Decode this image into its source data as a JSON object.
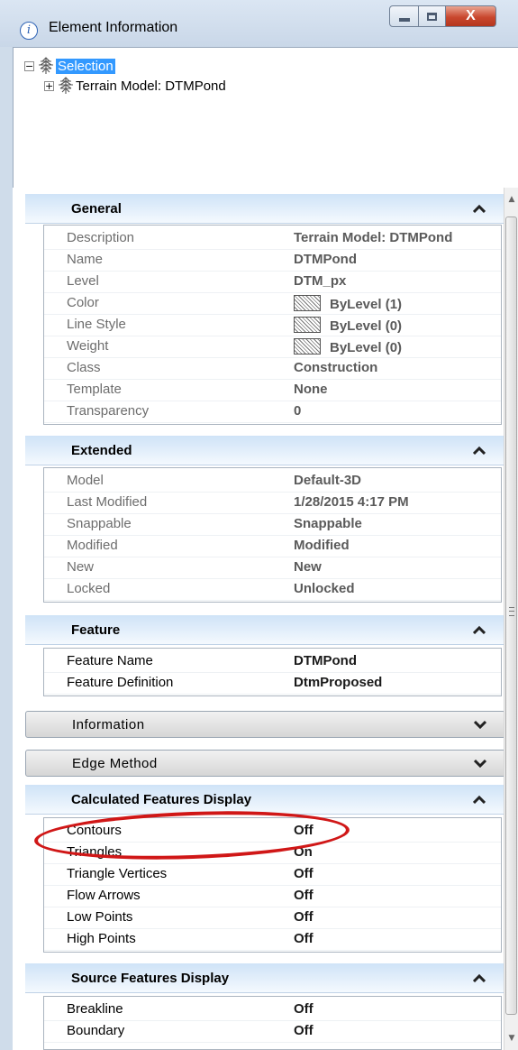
{
  "window": {
    "title": "Element Information",
    "close_glyph": "X"
  },
  "tree": {
    "root_label": "Selection",
    "root_expander": "−",
    "child_label": "Terrain Model: DTMPond",
    "child_expander": "+"
  },
  "sections": {
    "general": {
      "title": "General",
      "rows": [
        {
          "key": "Description",
          "value": "Terrain Model: DTMPond"
        },
        {
          "key": "Name",
          "value": "DTMPond"
        },
        {
          "key": "Level",
          "value": "DTM_px"
        },
        {
          "key": "Color",
          "value": "ByLevel (1)"
        },
        {
          "key": "Line Style",
          "value": "ByLevel (0)"
        },
        {
          "key": "Weight",
          "value": "ByLevel (0)"
        },
        {
          "key": "Class",
          "value": "Construction"
        },
        {
          "key": "Template",
          "value": "None"
        },
        {
          "key": "Transparency",
          "value": "0"
        }
      ]
    },
    "extended": {
      "title": "Extended",
      "rows": [
        {
          "key": "Model",
          "value": "Default-3D"
        },
        {
          "key": "Last Modified",
          "value": "1/28/2015 4:17 PM"
        },
        {
          "key": "Snappable",
          "value": "Snappable"
        },
        {
          "key": "Modified",
          "value": "Modified"
        },
        {
          "key": "New",
          "value": "New"
        },
        {
          "key": "Locked",
          "value": "Unlocked"
        }
      ]
    },
    "feature": {
      "title": "Feature",
      "rows": [
        {
          "key": "Feature Name",
          "value": "DTMPond"
        },
        {
          "key": "Feature Definition",
          "value": "DtmProposed"
        }
      ]
    },
    "information": {
      "title": "Information"
    },
    "edge_method": {
      "title": "Edge Method"
    },
    "calculated": {
      "title": "Calculated Features Display",
      "rows": [
        {
          "key": "Contours",
          "value": "Off"
        },
        {
          "key": "Triangles",
          "value": "On"
        },
        {
          "key": "Triangle Vertices",
          "value": "Off"
        },
        {
          "key": "Flow Arrows",
          "value": "Off"
        },
        {
          "key": "Low Points",
          "value": "Off"
        },
        {
          "key": "High Points",
          "value": "Off"
        }
      ]
    },
    "source": {
      "title": "Source Features Display",
      "rows": [
        {
          "key": "Breakline",
          "value": "Off"
        },
        {
          "key": "Boundary",
          "value": "Off"
        }
      ]
    }
  },
  "icons": {
    "title": "info-icon",
    "tree": "terrain-model-icon",
    "swatch": "hatched-swatch-icon",
    "expand": "chevron-down-icon",
    "collapse": "chevron-up-icon"
  },
  "colors": {
    "selection": "#3399ff",
    "header_gradient_top": "#cfe3f7",
    "callout": "#d01717",
    "close_button": "#c9472e"
  },
  "scroll_position": 0
}
